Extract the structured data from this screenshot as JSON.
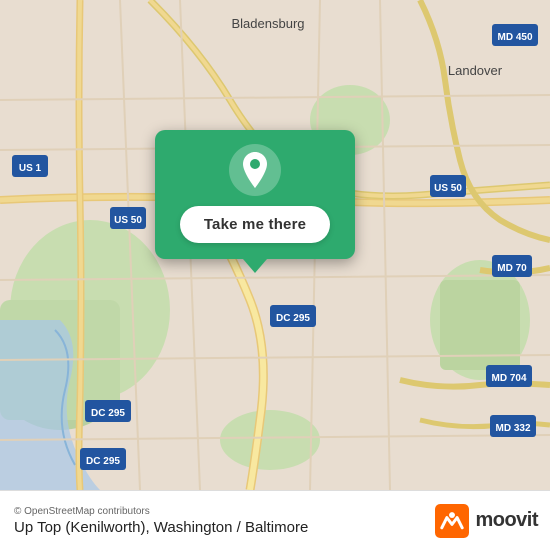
{
  "map": {
    "attribution": "© OpenStreetMap contributors",
    "bg_color": "#e8e0d8"
  },
  "popup": {
    "button_label": "Take me there",
    "bg_color": "#2eaa6e"
  },
  "bottom_bar": {
    "location_name": "Up Top (Kenilworth), Washington / Baltimore",
    "moovit_label": "moovit"
  }
}
